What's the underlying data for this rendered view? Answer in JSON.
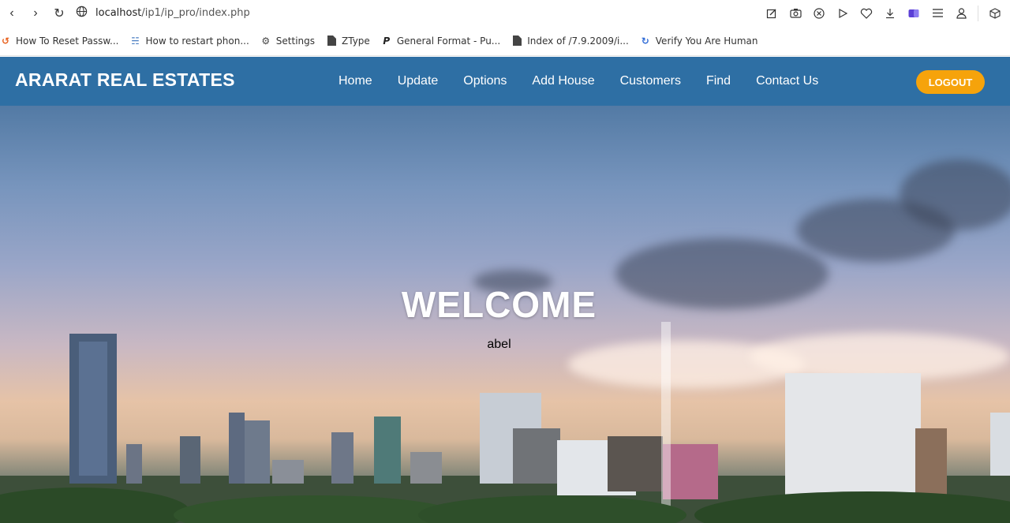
{
  "browser": {
    "url_host": "localhost",
    "url_path": "/ip1/ip_pro/index.php",
    "toolbar_icons": [
      "edit-icon",
      "camera-icon",
      "shield-icon",
      "play-icon",
      "heart-icon",
      "download-icon",
      "extension-icon",
      "menu-icon",
      "profile-icon",
      "cube-icon"
    ]
  },
  "bookmarks": [
    {
      "label": "How To Reset Passw...",
      "icon": "flame-icon"
    },
    {
      "label": "How to restart phon...",
      "icon": "bird-icon"
    },
    {
      "label": "Settings",
      "icon": "gear-icon"
    },
    {
      "label": "ZType",
      "icon": "file-icon"
    },
    {
      "label": "General Format - Pu...",
      "icon": "p-logo-icon"
    },
    {
      "label": "Index of /7.9.2009/i...",
      "icon": "file-icon"
    },
    {
      "label": "Verify You Are Human",
      "icon": "refresh-icon"
    }
  ],
  "site": {
    "brand": "ARARAT REAL ESTATES",
    "menu": [
      "Home",
      "Update",
      "Options",
      "Add House",
      "Customers",
      "Find",
      "Contact Us"
    ],
    "logout": "LOGOUT",
    "welcome": "WELCOME",
    "username": "abel"
  },
  "colors": {
    "navbar": "#2e6fa4",
    "logout": "#f6a30b"
  }
}
